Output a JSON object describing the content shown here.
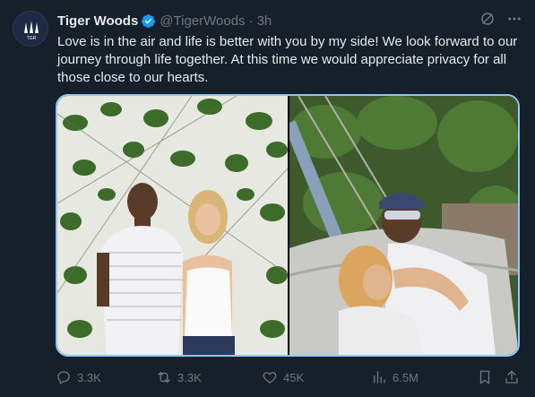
{
  "tweet": {
    "author_name": "Tiger Woods",
    "handle": "@TigerWoods",
    "separator": "·",
    "time": "3h",
    "text": "Love is in the air and life is better with you by my side! We look forward to our journey through life together. At this time we would appreciate privacy for all those close to our hearts.",
    "verified": true
  },
  "avatar": {
    "logo_text": "TGR"
  },
  "actions": {
    "replies": "3.3K",
    "reposts": "3.3K",
    "likes": "45K",
    "views": "6.5M"
  },
  "icons": {
    "verified": "verified-badge-icon",
    "grok": "grok-icon",
    "more": "more-icon",
    "reply": "reply-icon",
    "repost": "repost-icon",
    "like": "heart-icon",
    "views": "views-icon",
    "bookmark": "bookmark-icon",
    "share": "share-icon"
  },
  "colors": {
    "background": "#15202b",
    "text": "#e7e9ea",
    "muted": "#71767b",
    "accent": "#1d9bf0",
    "media_border": "#8ec7f5"
  }
}
